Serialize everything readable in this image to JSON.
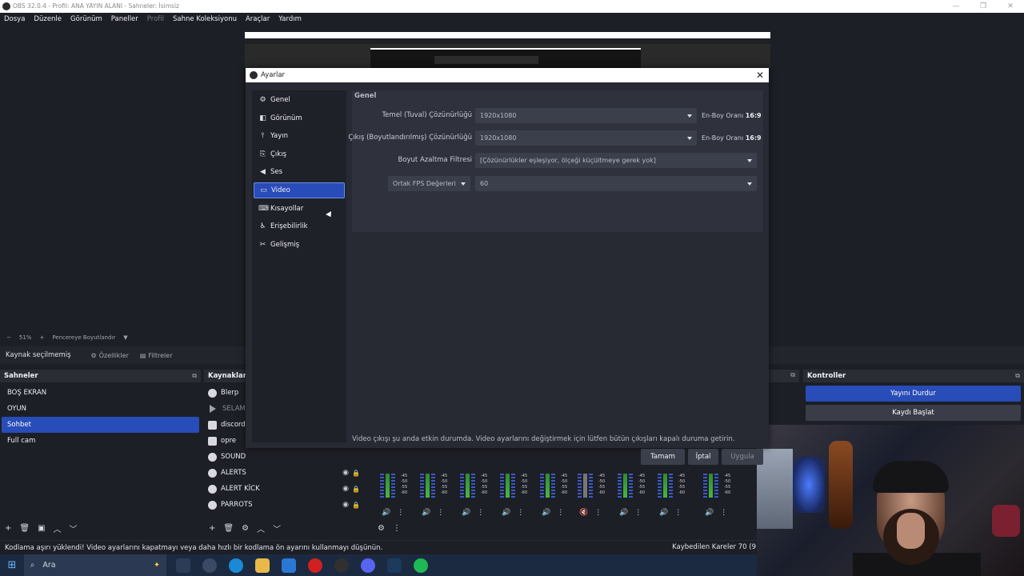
{
  "window": {
    "title": "OBS 32.0.4 - Profil: ANA YAYIN ALANI - Sahneler: İsimsiz",
    "controls": [
      "—",
      "❐",
      "✕"
    ]
  },
  "menu": [
    "Dosya",
    "Düzenle",
    "Görünüm",
    "Paneller",
    "Profil",
    "Sahne Koleksiyonu",
    "Araçlar",
    "Yardım"
  ],
  "preview": {
    "zoom_minus": "−",
    "zoom": "51%",
    "zoom_plus": "+",
    "fit_label": "Pencereye Boyutlandır"
  },
  "source_bar": {
    "status": "Kaynak seçilmemiş",
    "properties": "Özellikler",
    "filters": "Filtreler"
  },
  "scenes": {
    "title": "Sahneler",
    "items": [
      "BOŞ EKRAN",
      "OYUN",
      "Sohbet",
      "Full cam"
    ],
    "selected": "Sohbet"
  },
  "sources": {
    "title": "Kaynaklar",
    "items": [
      {
        "name": "Blerp",
        "icon": "browser-icon"
      },
      {
        "name": "SELAM_",
        "icon": "media-play-icon"
      },
      {
        "name": "discord",
        "icon": "window-capture-icon"
      },
      {
        "name": "opre",
        "icon": "window-capture-icon"
      },
      {
        "name": "SOUND",
        "icon": "browser-icon"
      },
      {
        "name": "ALERTS",
        "icon": "browser-icon"
      },
      {
        "name": "ALERT KİCK",
        "icon": "browser-icon"
      },
      {
        "name": "PARROTS",
        "icon": "browser-icon"
      }
    ]
  },
  "mixer": {
    "scale": [
      "-45",
      "-50",
      "-55",
      "-60"
    ]
  },
  "controls": {
    "title": "Kontroller",
    "stop_stream": "Yayını Durdur",
    "start_record": "Kaydı Başlat"
  },
  "status": {
    "message": "Kodlama aşırı yüklendi! Video ayarlarını kapatmayı veya daha hızlı bir kodlama ön ayarını kullanmayı düşünün.",
    "dropped": "Kaybedilen Kareler 70 (9"
  },
  "taskbar": {
    "search": "Ara"
  },
  "settings": {
    "title": "Ayarlar",
    "close": "✕",
    "nav": [
      {
        "label": "Genel",
        "icon": "gear-icon"
      },
      {
        "label": "Görünüm",
        "icon": "appearance-icon"
      },
      {
        "label": "Yayın",
        "icon": "antenna-icon"
      },
      {
        "label": "Çıkış",
        "icon": "output-icon"
      },
      {
        "label": "Ses",
        "icon": "speaker-icon"
      },
      {
        "label": "Video",
        "icon": "monitor-icon"
      },
      {
        "label": "Kısayollar",
        "icon": "keyboard-icon"
      },
      {
        "label": "Erişebilirlik",
        "icon": "accessibility-icon"
      },
      {
        "label": "Gelişmiş",
        "icon": "tools-icon"
      }
    ],
    "selected_nav": "Video",
    "section": "Genel",
    "base_label": "Temel (Tuval) Çözünürlüğü",
    "base_value": "1920x1080",
    "output_label": "Çıkış (Boyutlandırılmış) Çözünürlüğü",
    "output_value": "1920x1080",
    "ratio_prefix": "En-Boy Oranı",
    "ratio_value": "16:9",
    "filter_label": "Boyut Azaltma Filtresi",
    "filter_value": "[Çözünürlükler eşleşiyor, ölçeği küçültmeye gerek yok]",
    "fps_type": "Ortak FPS Değerleri",
    "fps_value": "60",
    "notice": "Video çıkışı şu anda etkin durumda. Video ayarlarını değiştirmek için lütfen bütün çıkışları kapalı duruma getirin.",
    "ok": "Tamam",
    "cancel": "İptal",
    "apply": "Uygula"
  }
}
